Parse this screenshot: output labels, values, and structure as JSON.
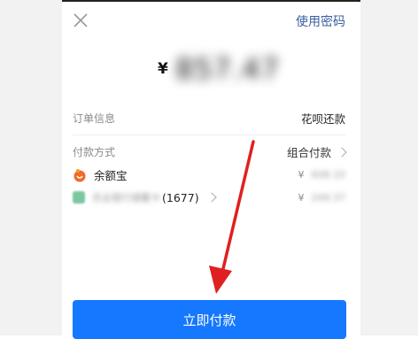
{
  "header": {
    "password_link": "使用密码"
  },
  "payment": {
    "currency_symbol": "¥",
    "amount": "857.47"
  },
  "order": {
    "label": "订单信息",
    "value": "花呗还款"
  },
  "pay_method": {
    "label": "付款方式",
    "value": "组合付款",
    "items": [
      {
        "name": "余额宝",
        "amount_symbol": "¥",
        "amount": "608.10",
        "icon": "yuebao-icon"
      },
      {
        "name": "农业银行储蓄卡",
        "suffix": "(1677)",
        "amount_symbol": "¥",
        "amount": "249.37",
        "icon": "bank-card-icon"
      }
    ]
  },
  "action": {
    "pay_button": "立即付款"
  },
  "colors": {
    "accent": "#1677ff",
    "link": "#3a5f9f",
    "arrow": "#e02020"
  }
}
